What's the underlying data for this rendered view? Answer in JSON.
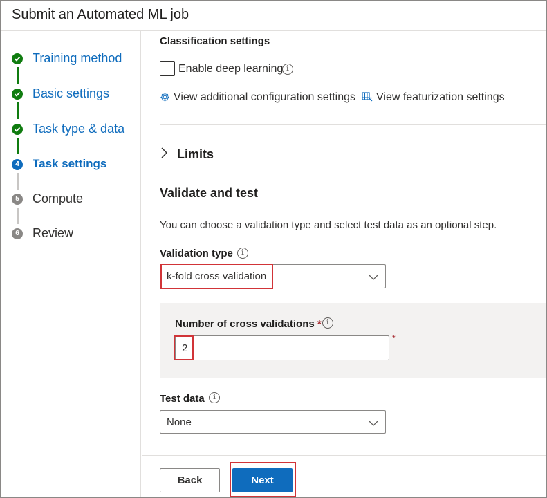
{
  "header": {
    "title": "Submit an Automated ML job"
  },
  "steps": [
    {
      "label": "Training method",
      "state": "done",
      "marker": ""
    },
    {
      "label": "Basic settings",
      "state": "done",
      "marker": ""
    },
    {
      "label": "Task type & data",
      "state": "done",
      "marker": ""
    },
    {
      "label": "Task settings",
      "state": "active",
      "marker": "4"
    },
    {
      "label": "Compute",
      "state": "todo",
      "marker": "5"
    },
    {
      "label": "Review",
      "state": "todo",
      "marker": "6"
    }
  ],
  "classification": {
    "title": "Classification settings",
    "deep_learning_label": "Enable deep learning",
    "deep_learning_checked": false,
    "additional_config_link": "View additional configuration settings",
    "featurization_link": "View featurization settings"
  },
  "limits": {
    "label": "Limits"
  },
  "validate": {
    "title": "Validate and test",
    "description": "You can choose a validation type and select test data as an optional step.",
    "validation_type_label": "Validation type",
    "validation_type_value": "k-fold cross validation",
    "cross_validations_label": "Number of cross validations",
    "required_marker": "*",
    "cross_validations_value": "2",
    "test_data_label": "Test data",
    "test_data_value": "None"
  },
  "footer": {
    "back_label": "Back",
    "next_label": "Next"
  },
  "colors": {
    "accent": "#0f6cbd",
    "success": "#107c10",
    "highlight": "#d13438",
    "required": "#a4262c"
  },
  "icons": {
    "done_step": "checkmark-icon",
    "info": "info-icon",
    "settings": "gear-icon",
    "featurization": "table-icon",
    "expand": "chevron-right-icon",
    "dropdown": "chevron-down-icon"
  }
}
